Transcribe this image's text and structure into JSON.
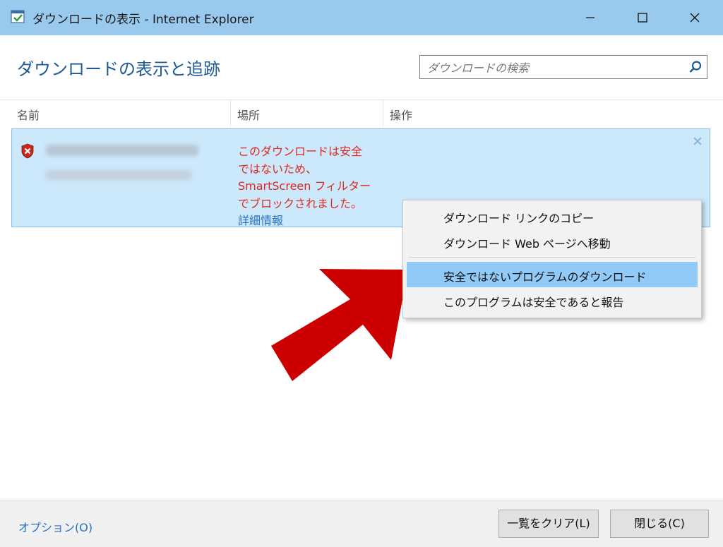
{
  "window": {
    "title": "ダウンロードの表示 - Internet Explorer"
  },
  "header": {
    "page_title": "ダウンロードの表示と追跡",
    "search_placeholder": "ダウンロードの検索"
  },
  "columns": [
    "名前",
    "場所",
    "操作"
  ],
  "download_row": {
    "warning_lines": [
      "このダウンロードは安全",
      "ではないため、",
      "SmartScreen フィルター",
      "でブロックされました。"
    ],
    "details_link": "詳細情報"
  },
  "context_menu": {
    "items": [
      "ダウンロード リンクのコピー",
      "ダウンロード Web ページへ移動",
      "安全ではないプログラムのダウンロード",
      "このプログラムは安全であると報告"
    ],
    "active_index": 2
  },
  "footer": {
    "options_link": "オプション(O)",
    "clear_button": "一覧をクリア(L)",
    "close_button": "閉じる(C)"
  },
  "colors": {
    "titlebar": "#99c9ed",
    "row_selected": "#cce8fb",
    "warning_text": "#e0261f",
    "link": "#2a6fc0",
    "menu_highlight": "#91c9f7",
    "arrow": "#cc0000"
  }
}
